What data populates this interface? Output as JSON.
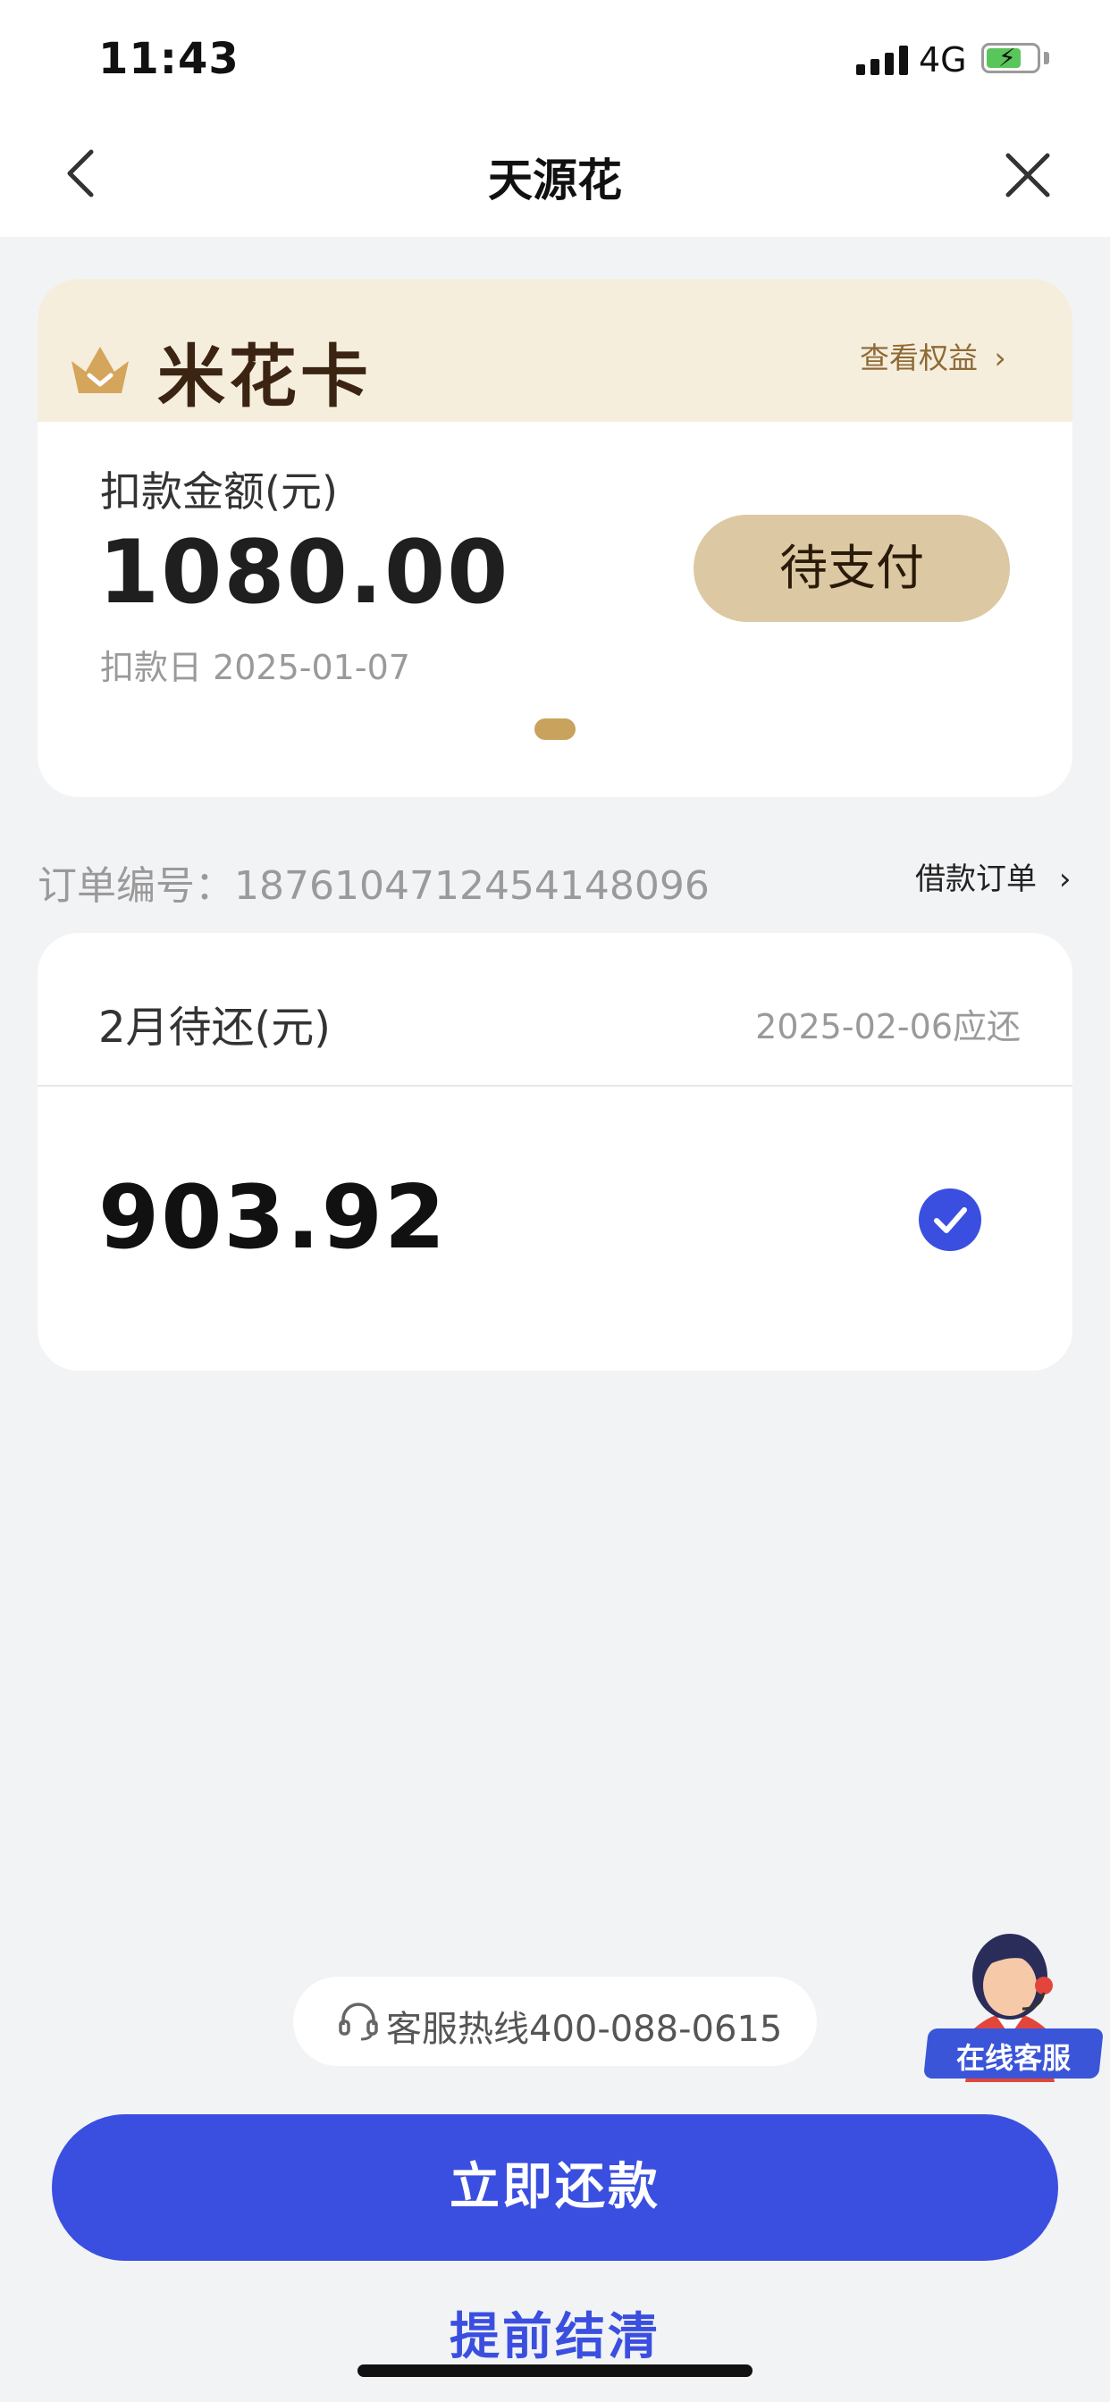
{
  "status_bar": {
    "time": "11:43",
    "network": "4G",
    "icons": [
      "cellular-signal-icon",
      "battery-charging-icon"
    ]
  },
  "header": {
    "title": "天源花",
    "back_icon": "chevron-left-icon",
    "close_icon": "close-icon"
  },
  "card": {
    "brand": "米花卡",
    "benefits_link": "查看权益",
    "amount_label": "扣款金额(元)",
    "amount": "1080.00",
    "deduct_date": "扣款日 2025-01-07",
    "status_button": "待支付",
    "colors": {
      "band": "#f5eedd",
      "button": "#dcc8a2",
      "dot": "#c9a25d"
    }
  },
  "order": {
    "label": "订单编号：1876104712454148096",
    "link": "借款订单"
  },
  "repayment": {
    "label": "2月待还(元)",
    "due": "2025-02-06应还",
    "amount": "903.92",
    "checked": true
  },
  "hotline": {
    "text": "客服热线400-088-0615",
    "icon": "headset-icon"
  },
  "online_service": {
    "label": "在线客服"
  },
  "buttons": {
    "repay_now": "立即还款",
    "settle_early": "提前结清"
  },
  "colors": {
    "primary": "#3a4fe0",
    "background": "#f2f3f5"
  }
}
